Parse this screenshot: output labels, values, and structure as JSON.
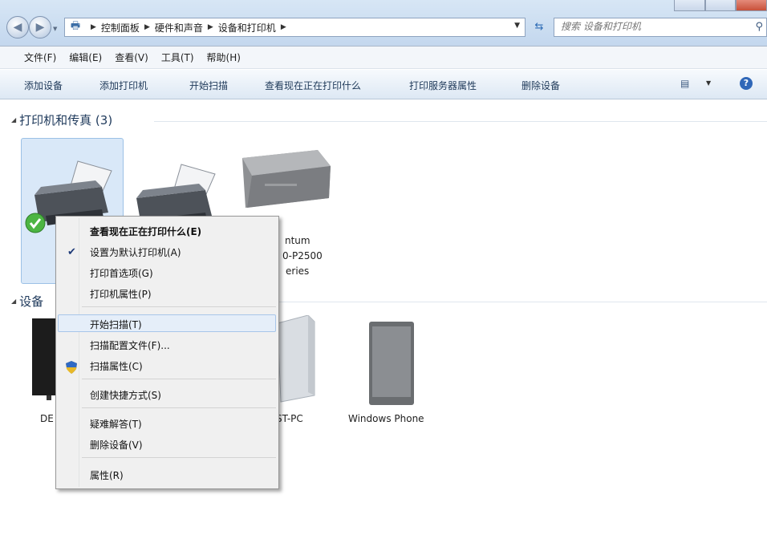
{
  "window": {
    "breadcrumb": [
      "控制面板",
      "硬件和声音",
      "设备和打印机"
    ],
    "search_placeholder": "搜索 设备和打印机"
  },
  "menubar": [
    "文件(F)",
    "编辑(E)",
    "查看(V)",
    "工具(T)",
    "帮助(H)"
  ],
  "commandbar": [
    "添加设备",
    "添加打印机",
    "开始扫描",
    "查看现在正在打印什么",
    "打印服务器属性",
    "删除设备"
  ],
  "groups": {
    "printers": {
      "title": "打印机和传真 (3)"
    },
    "devices": {
      "title": "设备"
    }
  },
  "devices": {
    "printer3_label": [
      "ntum",
      "0-P2500",
      "eries"
    ],
    "computer1_label": "DE",
    "computer2_label": "ST-PC",
    "phone_label": "Windows Phone"
  },
  "context_menu": {
    "items": [
      "查看现在正在打印什么(E)",
      "设置为默认打印机(A)",
      "打印首选项(G)",
      "打印机属性(P)",
      "开始扫描(T)",
      "扫描配置文件(F)...",
      "扫描属性(C)",
      "创建快捷方式(S)",
      "疑难解答(T)",
      "删除设备(V)",
      "属性(R)"
    ],
    "checked_item": "设置为默认打印机(A)",
    "highlighted_item": "开始扫描(T)"
  },
  "icons": [
    "back-arrow-icon",
    "forward-arrow-icon",
    "control-panel-icon",
    "refresh-icon",
    "search-icon",
    "view-toggle-icon",
    "help-icon",
    "printer-icon",
    "default-check-icon",
    "monitor-icon",
    "pc-tower-icon",
    "phone-icon",
    "shield-icon"
  ]
}
